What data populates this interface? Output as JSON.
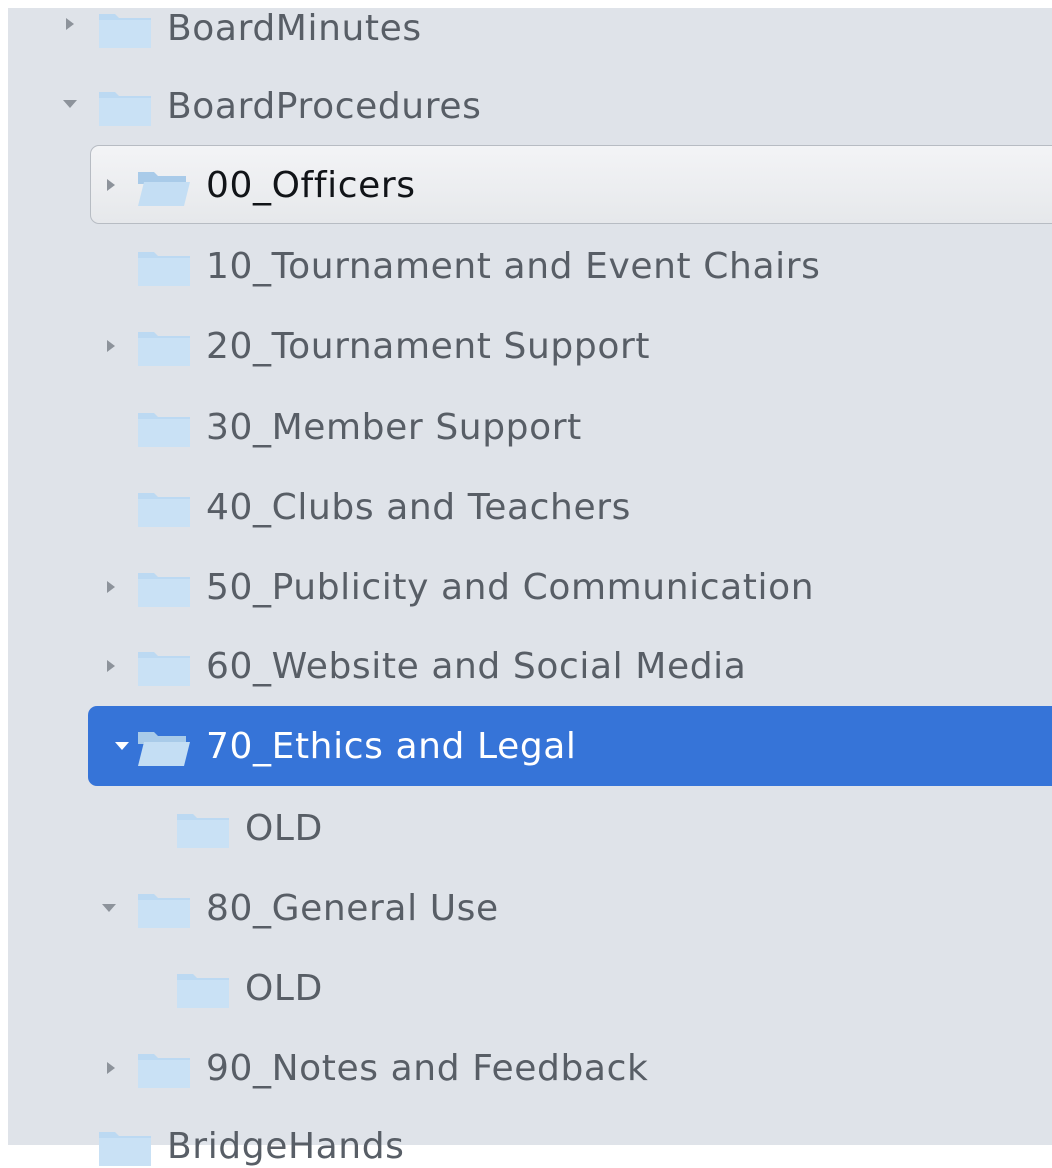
{
  "tree": {
    "items": [
      {
        "label": "BoardMinutes",
        "icon": "folder-icon",
        "expander": "collapsed"
      },
      {
        "label": "BoardProcedures",
        "icon": "folder-icon",
        "expander": "expanded"
      },
      {
        "label": "00_Officers",
        "icon": "folder-open-icon",
        "expander": "collapsed",
        "state": "hovered"
      },
      {
        "label": "10_Tournament and Event Chairs",
        "icon": "folder-icon",
        "expander": "none"
      },
      {
        "label": "20_Tournament Support",
        "icon": "folder-icon",
        "expander": "collapsed"
      },
      {
        "label": "30_Member Support",
        "icon": "folder-icon",
        "expander": "none"
      },
      {
        "label": "40_Clubs and Teachers",
        "icon": "folder-icon",
        "expander": "none"
      },
      {
        "label": "50_Publicity and Communication",
        "icon": "folder-icon",
        "expander": "collapsed"
      },
      {
        "label": "60_Website and Social Media",
        "icon": "folder-icon",
        "expander": "collapsed"
      },
      {
        "label": "70_Ethics and Legal",
        "icon": "folder-open-icon",
        "expander": "expanded",
        "state": "selected"
      },
      {
        "label": "OLD",
        "icon": "folder-icon",
        "expander": "none"
      },
      {
        "label": "80_General Use",
        "icon": "folder-icon",
        "expander": "expanded"
      },
      {
        "label": "OLD",
        "icon": "folder-icon",
        "expander": "none"
      },
      {
        "label": "90_Notes and Feedback",
        "icon": "folder-icon",
        "expander": "collapsed"
      },
      {
        "label": "BridgeHands",
        "icon": "folder-icon",
        "expander": "none"
      }
    ]
  },
  "colors": {
    "pane_background": "#dfe3e9",
    "selection": "#3674d8",
    "folder": "#bcd9f2",
    "text": "#585e66"
  }
}
